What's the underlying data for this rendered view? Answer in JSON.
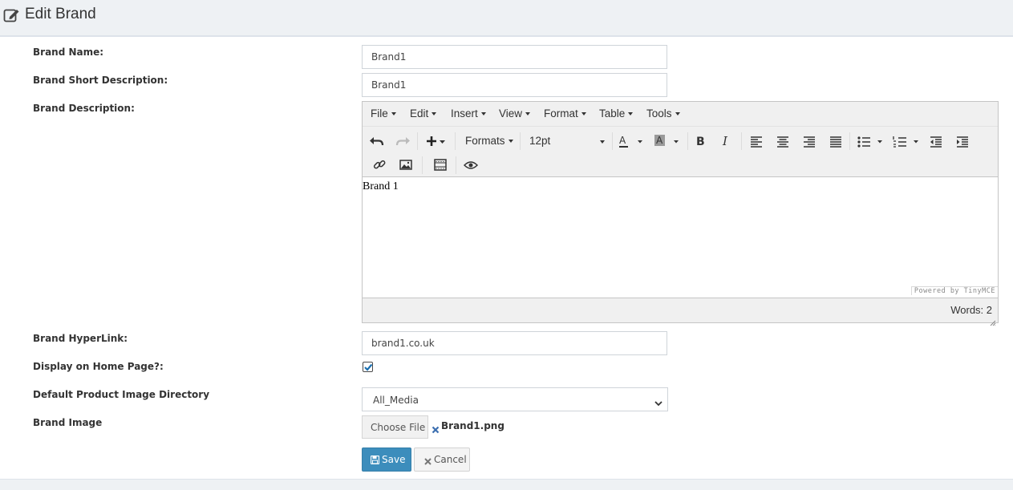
{
  "header": {
    "title": "Edit Brand",
    "icon": "edit-icon"
  },
  "form": {
    "brand_name": {
      "label": "Brand Name:",
      "value": "Brand1"
    },
    "short_description": {
      "label": "Brand Short Description:",
      "value": "Brand1"
    },
    "description": {
      "label": "Brand Description:",
      "menu": [
        "File",
        "Edit",
        "Insert",
        "View",
        "Format",
        "Table",
        "Tools"
      ],
      "toolbar": {
        "formats_label": "Formats",
        "font_size": "12pt"
      },
      "content": "Brand 1",
      "powered_by": "Powered by TinyMCE",
      "word_count": "Words: 2"
    },
    "hyperlink": {
      "label": "Brand HyperLink:",
      "value": "brand1.co.uk"
    },
    "display_home": {
      "label": "Display on Home Page?:",
      "checked": true
    },
    "image_directory": {
      "label": "Default Product Image Directory",
      "value": "All_Media"
    },
    "brand_image": {
      "label": "Brand Image",
      "choose_label": "Choose File",
      "file_name": "Brand1.png"
    }
  },
  "actions": {
    "save_label": "Save",
    "cancel_label": "Cancel"
  },
  "colors": {
    "primary": "#3c8dbc",
    "header_bg": "#eef1f4"
  }
}
